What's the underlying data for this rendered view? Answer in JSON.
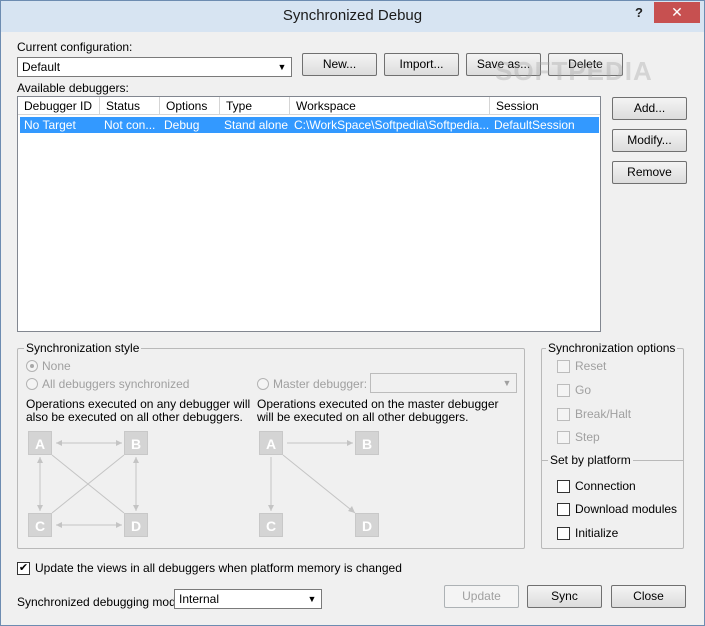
{
  "window": {
    "title": "Synchronized Debug",
    "help_glyph": "?",
    "close_glyph": "✕"
  },
  "config": {
    "label": "Current configuration:",
    "value": "Default",
    "new_label": "New...",
    "import_label": "Import...",
    "saveas_label": "Save as...",
    "delete_label": "Delete"
  },
  "debuggers": {
    "label": "Available debuggers:",
    "columns": [
      "Debugger ID",
      "Status",
      "Options",
      "Type",
      "Workspace",
      "Session"
    ],
    "rows": [
      [
        "No Target",
        "Not con...",
        "Debug",
        "Stand alone",
        "C:\\WorkSpace\\Softpedia\\Softpedia....",
        "DefaultSession"
      ]
    ],
    "add_label": "Add...",
    "modify_label": "Modify...",
    "remove_label": "Remove"
  },
  "sync_style": {
    "title": "Synchronization style",
    "none_label": "None",
    "all_label": "All debuggers synchronized",
    "all_desc_1": "Operations executed on any debugger will",
    "all_desc_2": "also be executed on all other debuggers.",
    "master_label": "Master debugger:",
    "master_desc_1": "Operations executed on the master debugger",
    "master_desc_2": "will be executed on all other debuggers.",
    "node_a": "A",
    "node_b": "B",
    "node_c": "C",
    "node_d": "D"
  },
  "sync_options": {
    "title": "Synchronization options",
    "reset": "Reset",
    "go": "Go",
    "break": "Break/Halt",
    "step": "Step"
  },
  "platform": {
    "title": "Set by platform",
    "connection": "Connection",
    "download": "Download modules",
    "initialize": "Initialize"
  },
  "footer": {
    "update_views_label": "Update the views in all debuggers when platform memory is changed",
    "update_views_checked": "✔",
    "mode_label": "Synchronized debugging mode:",
    "mode_value": "Internal",
    "update_label": "Update",
    "sync_label": "Sync",
    "close_label": "Close"
  },
  "watermark": "SOFTPEDIA",
  "colors": {
    "selection": "#3399ff",
    "titlebar": "#d7e4f2",
    "close_button": "#c75050"
  }
}
